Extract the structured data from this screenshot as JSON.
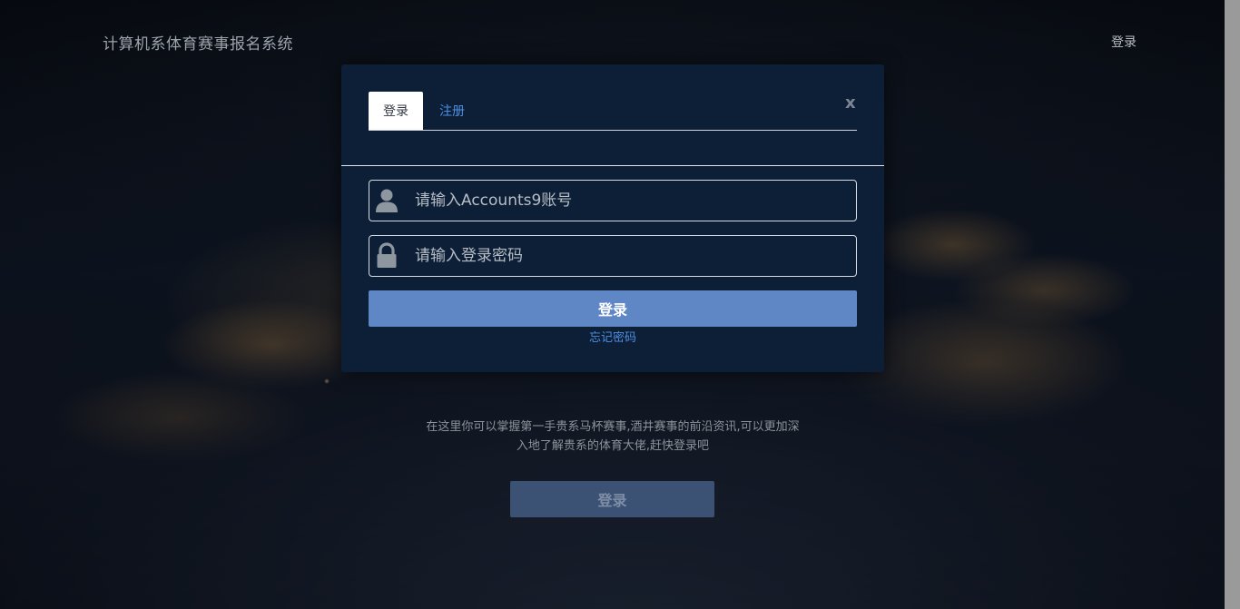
{
  "header": {
    "site_title": "计算机系体育赛事报名系统",
    "login_link": "登录"
  },
  "intro": {
    "line1": "在这里你可以掌握第一手贵系马杯赛事,酒井赛事的前沿资讯,可以更加深",
    "line2": "入地了解贵系的体育大佬,赶快登录吧"
  },
  "bottom_login_label": "登录",
  "modal": {
    "tabs": [
      {
        "label": "登录",
        "active": true
      },
      {
        "label": "注册",
        "active": false
      }
    ],
    "close_label": "x",
    "username": {
      "placeholder": "请输入Accounts9账号",
      "value": "",
      "icon": "user-icon"
    },
    "password": {
      "placeholder": "请输入登录密码",
      "value": "",
      "icon": "lock-icon"
    },
    "submit_label": "登录",
    "forgot_label": "忘记密码"
  },
  "colors": {
    "modal_bg": "#0d1f37",
    "submit_bg": "#5f86c5",
    "link": "#4d8ee0",
    "bottom_button_bg": "#3b5274"
  }
}
